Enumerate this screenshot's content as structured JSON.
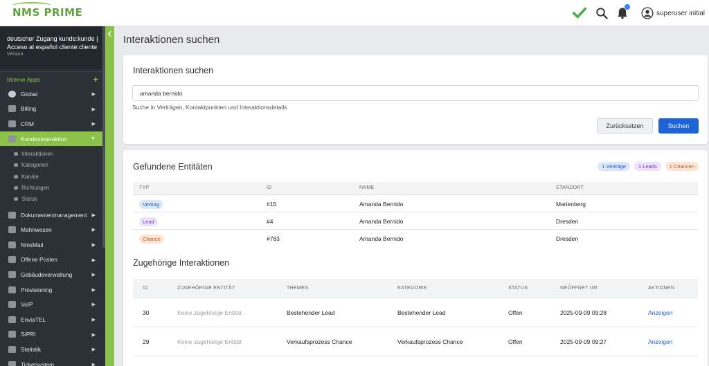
{
  "app": {
    "logo_text": "NMS PRIME"
  },
  "topbar": {
    "user_name": "superuser initial"
  },
  "sidebar": {
    "head_line1": "deutscher Zugang kunde:kunde |",
    "head_line2": "Acceso al español cliente:cliente",
    "version": "Version",
    "section_label": "Interne Apps",
    "items_top": [
      {
        "label": "Global"
      },
      {
        "label": "Billing"
      },
      {
        "label": "CRM"
      }
    ],
    "active_item": {
      "label": "Kundeninteraktion"
    },
    "sub_items": [
      {
        "label": "Interaktionen"
      },
      {
        "label": "Kategorien"
      },
      {
        "label": "Kanäle"
      },
      {
        "label": "Richtungen"
      },
      {
        "label": "Status"
      }
    ],
    "items_bottom": [
      {
        "label": "Dokumentenmanagement"
      },
      {
        "label": "Mahnwesen"
      },
      {
        "label": "NmsMail"
      },
      {
        "label": "Offene Posten"
      },
      {
        "label": "Gebäudeverwaltung"
      },
      {
        "label": "Provisioning"
      },
      {
        "label": "VoIP"
      },
      {
        "label": "EnviaTEL"
      },
      {
        "label": "S/PRI"
      },
      {
        "label": "Statistik"
      },
      {
        "label": "Ticketsystem"
      }
    ]
  },
  "page": {
    "title": "Interaktionen suchen"
  },
  "search": {
    "card_title": "Interaktionen suchen",
    "query": "amanda bernido",
    "help": "Suche in Verträgen, Kontaktpunkten und Interaktionsdetails",
    "reset_label": "Zurücksetzen",
    "submit_label": "Suchen"
  },
  "entities": {
    "title": "Gefundene Entitäten",
    "badges": {
      "contracts": "1 Verträge",
      "leads": "1 Leads",
      "chances": "1 Chancen"
    },
    "headers": {
      "type": "TYP",
      "id": "ID",
      "name": "NAME",
      "location": "STANDORT"
    },
    "rows": [
      {
        "type": "Vertrag",
        "id": "#15",
        "name": "Amanda Bernido",
        "location": "Marienberg"
      },
      {
        "type": "Lead",
        "id": "#4",
        "name": "Amanda Bernido",
        "location": "Dresden"
      },
      {
        "type": "Chance",
        "id": "#783",
        "name": "Amanda Bernido",
        "location": "Dresden"
      }
    ]
  },
  "interactions": {
    "title": "Zugehörige Interaktionen",
    "headers": {
      "id": "ID",
      "entity": "ZUGEHÖRIGE ENTITÄT",
      "topics": "THEMEN",
      "category": "KATEGORIE",
      "status": "STATUS",
      "opened": "GEÖFFNET UM",
      "actions": "AKTIONEN"
    },
    "rows": [
      {
        "id": "30",
        "entity": "Keine zugehörige Entität",
        "topics": "Bestehender Lead",
        "category": "Bestehender Lead",
        "status": "Offen",
        "opened": "2025-09-09 09:28",
        "action": "Anzeigen"
      },
      {
        "id": "29",
        "entity": "Keine zugehörige Entität",
        "topics": "Verkaufsprozess Chance",
        "category": "Verkaufsprozess Chance",
        "status": "Offen",
        "opened": "2025-09-09 09:27",
        "action": "Anzeigen"
      }
    ]
  },
  "colors": {
    "accent_green": "#8bc34a",
    "primary_blue": "#1f63d8",
    "sidebar_bg": "#2b3137"
  }
}
